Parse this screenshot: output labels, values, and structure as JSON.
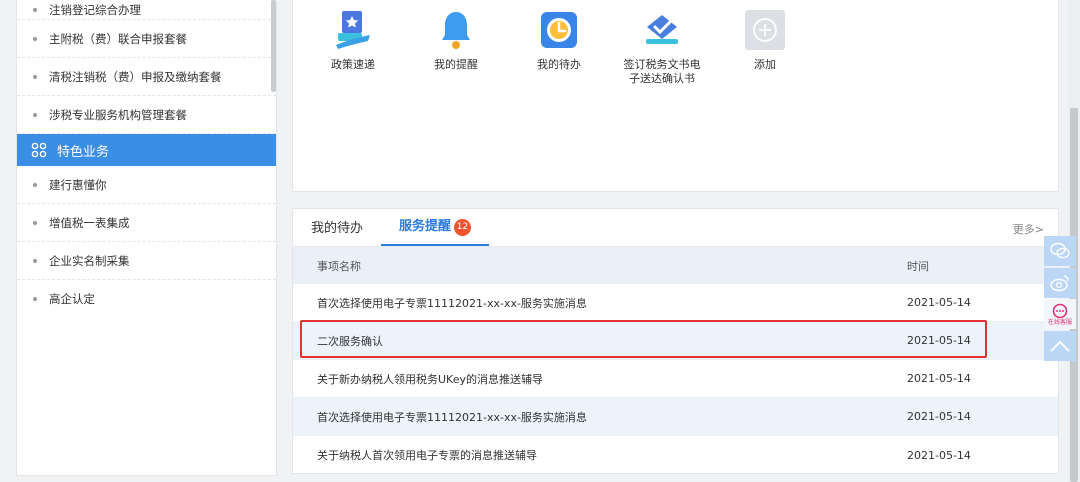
{
  "sidebar": {
    "items_top": [
      {
        "label": "注销登记综合办理"
      },
      {
        "label": "主附税（费）联合申报套餐"
      },
      {
        "label": "清税注销税（费）申报及缴纳套餐"
      },
      {
        "label": "涉税专业服务机构管理套餐"
      }
    ],
    "group": {
      "label": "特色业务",
      "icon": "grid-icon"
    },
    "items_bottom": [
      {
        "label": "建行惠懂你"
      },
      {
        "label": "增值税一表集成"
      },
      {
        "label": "企业实名制采集"
      },
      {
        "label": "高企认定"
      }
    ],
    "accent": "#3a8ee6"
  },
  "shortcuts": [
    {
      "label": "政策速递",
      "icon": "policy-book-icon"
    },
    {
      "label": "我的提醒",
      "icon": "bell-icon"
    },
    {
      "label": "我的待办",
      "icon": "clock-icon"
    },
    {
      "label": "签订税务文书电子送达确认书",
      "icon": "sign-document-icon"
    },
    {
      "label": "添加",
      "icon": "plus-icon"
    }
  ],
  "tabs": {
    "tab1": "我的待办",
    "tab2": "服务提醒",
    "tab2_badge": "12",
    "more": "更多>"
  },
  "table": {
    "headers": {
      "name": "事项名称",
      "time": "时间"
    },
    "rows": [
      {
        "name": "首次选择使用电子专票11112021-xx-xx-服务实施消息",
        "time": "2021-05-14"
      },
      {
        "name": "二次服务确认",
        "time": "2021-05-14"
      },
      {
        "name": "关于新办纳税人领用税务UKey的消息推送辅导",
        "time": "2021-05-14"
      },
      {
        "name": "首次选择使用电子专票11112021-xx-xx-服务实施消息",
        "time": "2021-05-14"
      },
      {
        "name": "关于纳税人首次领用电子专票的消息推送辅导",
        "time": "2021-05-14"
      }
    ]
  },
  "float_buttons": {
    "kefu_label": "在线客服"
  },
  "colors": {
    "tab_active": "#2d7be0",
    "badge": "#f0532f",
    "highlight_border": "#e53030"
  }
}
